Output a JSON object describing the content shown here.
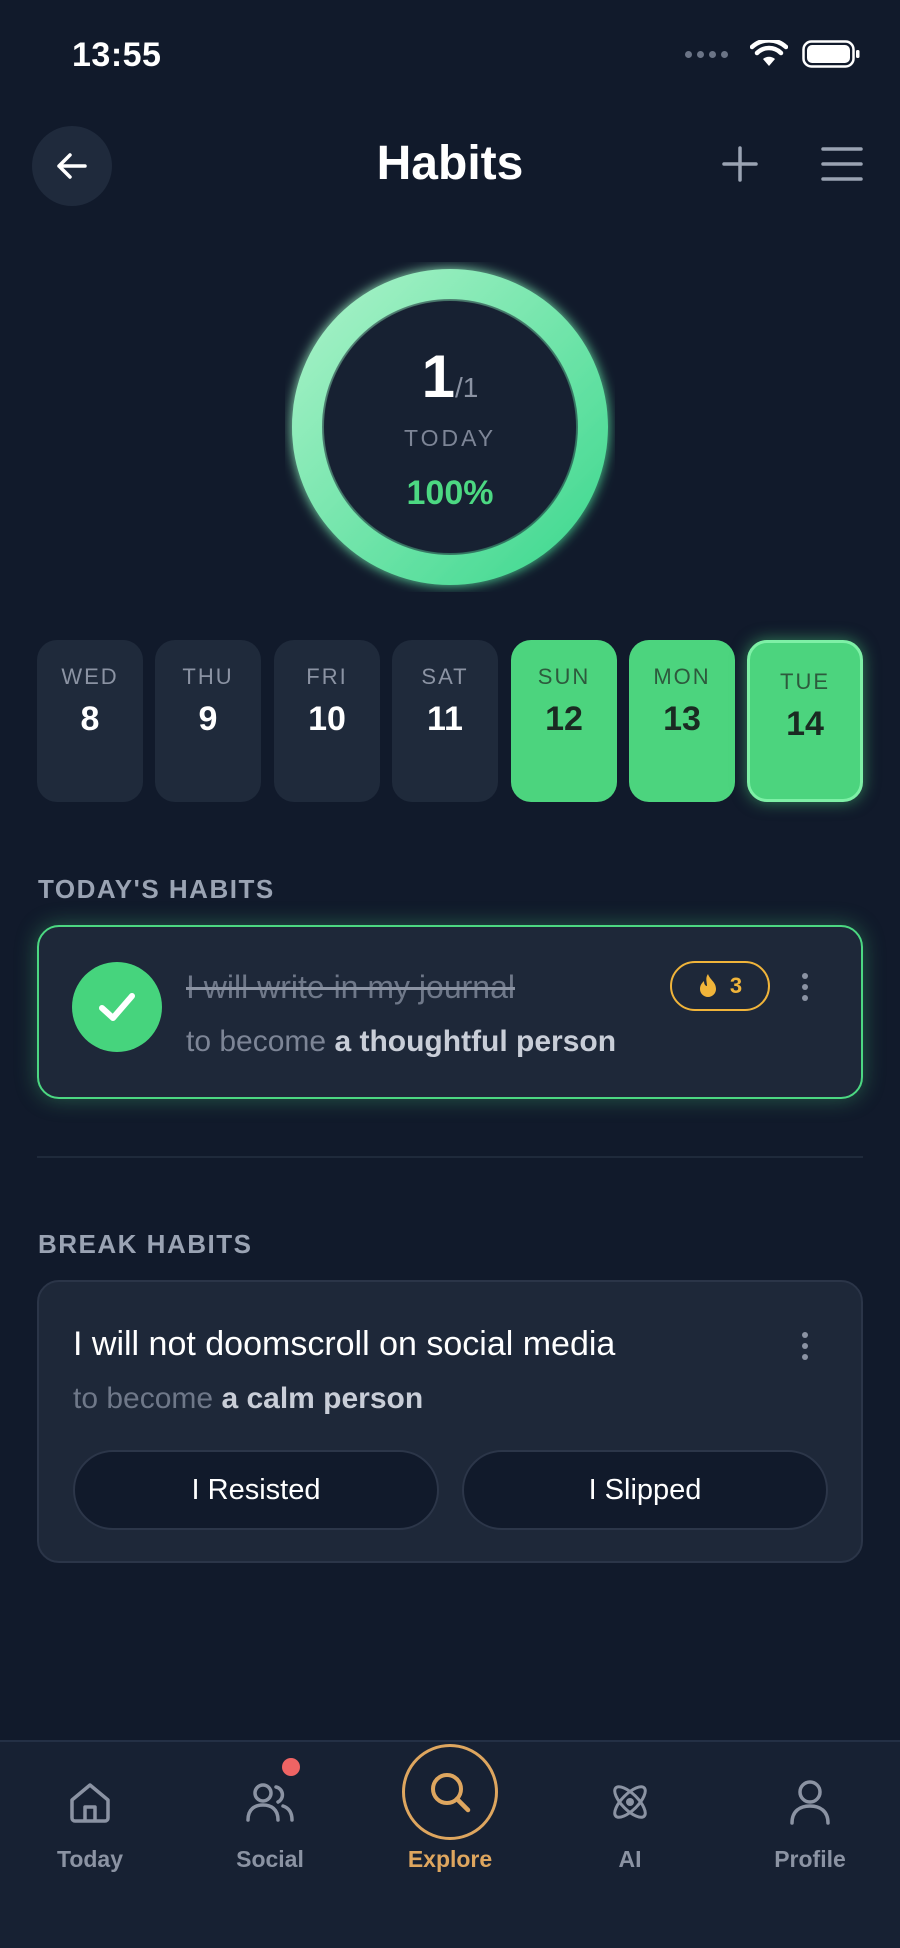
{
  "status_bar": {
    "time": "13:55",
    "wifi_icon": "wifi-icon",
    "battery_icon": "battery-icon"
  },
  "header": {
    "title": "Habits",
    "back_icon": "arrow-left-icon",
    "add_icon": "plus-icon",
    "menu_icon": "hamburger-menu-icon"
  },
  "progress": {
    "count": "1",
    "total": "/1",
    "label": "TODAY",
    "percent": "100%",
    "fraction": 1.0
  },
  "days": [
    {
      "name": "WED",
      "num": "8",
      "done": false,
      "today": false
    },
    {
      "name": "THU",
      "num": "9",
      "done": false,
      "today": false
    },
    {
      "name": "FRI",
      "num": "10",
      "done": false,
      "today": false
    },
    {
      "name": "SAT",
      "num": "11",
      "done": false,
      "today": false
    },
    {
      "name": "SUN",
      "num": "12",
      "done": true,
      "today": false
    },
    {
      "name": "MON",
      "num": "13",
      "done": true,
      "today": false
    },
    {
      "name": "TUE",
      "num": "14",
      "done": true,
      "today": true
    }
  ],
  "todays_habits": {
    "section_title": "TODAY'S HABITS",
    "items": [
      {
        "title": "I will write in my journal",
        "sub_prefix": "to become",
        "sub_identity": "a thoughtful person",
        "streak": "3",
        "completed": true
      }
    ]
  },
  "break_habits": {
    "section_title": "BREAK HABITS",
    "items": [
      {
        "title": "I will not doomscroll on social media",
        "sub_prefix": "to become",
        "sub_identity": "a calm person",
        "resisted_label": "I Resisted",
        "slipped_label": "I Slipped"
      }
    ]
  },
  "tabs": [
    {
      "label": "Today",
      "icon": "home-icon",
      "active": false
    },
    {
      "label": "Social",
      "icon": "users-icon",
      "active": false,
      "badge": true
    },
    {
      "label": "Explore",
      "icon": "search-icon",
      "active": true
    },
    {
      "label": "AI",
      "icon": "atom-icon",
      "active": false
    },
    {
      "label": "Profile",
      "icon": "user-icon",
      "active": false
    }
  ],
  "colors": {
    "background": "#111a2b",
    "accent_green": "#4cd882",
    "accent_gold": "#dea65f",
    "streak_gold": "#f0b43a",
    "badge_red": "#ef6464"
  }
}
